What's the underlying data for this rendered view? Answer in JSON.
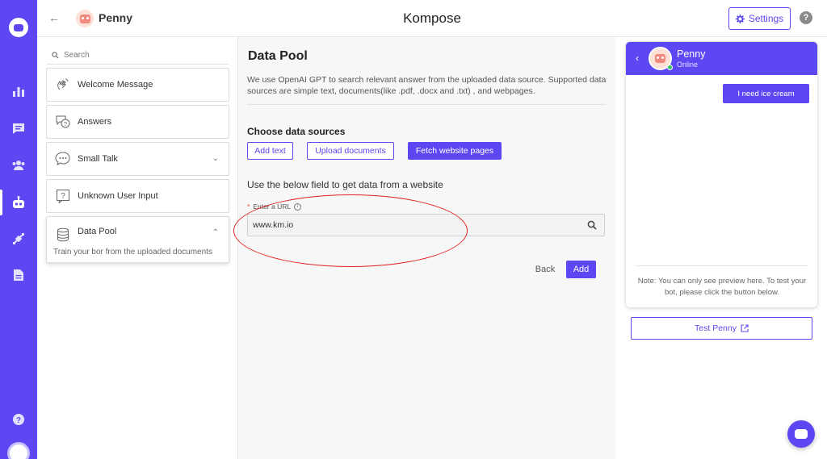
{
  "header": {
    "bot_name": "Penny",
    "app_title": "Kompose",
    "settings_label": "Settings"
  },
  "rail": {
    "icons": [
      "chat-logo-icon",
      "bar-chart-icon",
      "conversations-icon",
      "users-icon",
      "bot-icon",
      "integrations-icon",
      "document-icon",
      "help-icon",
      "user-avatar"
    ],
    "active": "bot-icon"
  },
  "sidebar": {
    "search_placeholder": "Search",
    "items": [
      {
        "label": "Welcome Message",
        "icon": "wave-hand-icon"
      },
      {
        "label": "Answers",
        "icon": "answers-bubble-icon"
      },
      {
        "label": "Small Talk",
        "icon": "chat-bubble-dots-icon",
        "has_chevron": true
      },
      {
        "label": "Unknown User Input",
        "icon": "question-box-icon"
      },
      {
        "label": "Data Pool",
        "icon": "database-icon",
        "expanded": true,
        "subtitle": "Train your bor from the uploaded documents"
      }
    ]
  },
  "main": {
    "title": "Data Pool",
    "description": "We use OpenAI GPT to search relevant answer from the uploaded data source. Supported data sources are simple text, documents(like .pdf, .docx and .txt) , and webpages.",
    "choose_heading": "Choose data sources",
    "sources": [
      "Add text",
      "Upload documents",
      "Fetch website pages"
    ],
    "active_source": "Fetch website pages",
    "use_below": "Use the below field to get data from a website",
    "url_label": "Enter a URL",
    "url_required_mark": "*",
    "url_value": "www.km.io",
    "back_label": "Back",
    "add_label": "Add"
  },
  "preview": {
    "bot_name": "Penny",
    "status": "Online",
    "user_message": "I need ice cream",
    "note": "Note: You can only see preview here. To test your bot, please click the button below.",
    "test_label": "Test Penny"
  },
  "colors": {
    "accent": "#5c47f2",
    "annotation": "#e02020",
    "online": "#37c469"
  }
}
